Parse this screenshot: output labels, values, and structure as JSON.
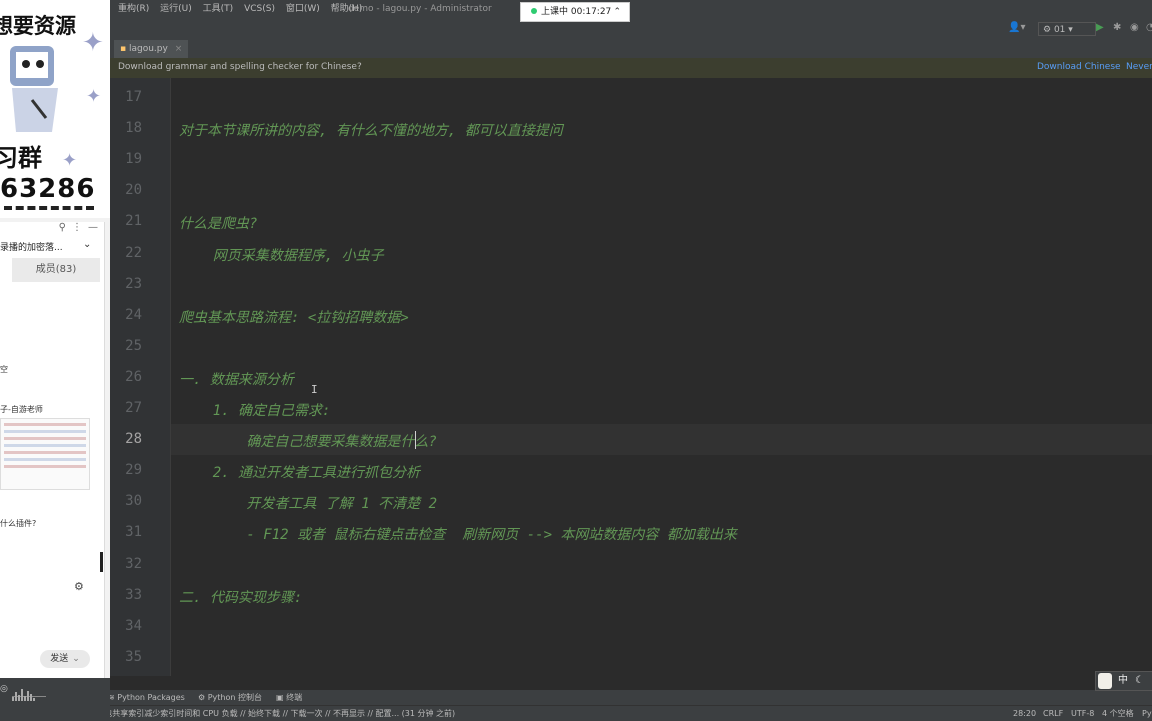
{
  "overlay": {
    "promo_line1": "想要资源",
    "promo_line2": "习群",
    "promo_line3": "63286",
    "chat": {
      "group_title": "录播的加密落...",
      "members_label": "成员(83)",
      "msg_1": "空",
      "msg_2": "子-自游老师",
      "msg_3": "什么插件?",
      "send_label": "发送"
    }
  },
  "ide": {
    "menu": [
      "重构(R)",
      "运行(U)",
      "工具(T)",
      "VCS(S)",
      "窗口(W)",
      "帮助(H)"
    ],
    "window_title": "demo - lagou.py - Administrator",
    "timer_label": "上课中 00:17:27",
    "run_config": "01",
    "tab_name": "lagou.py",
    "notice": {
      "message": "Download grammar and spelling checker for Chinese?",
      "action_download": "Download Chinese",
      "action_never": "Never"
    },
    "current_line": 28,
    "lines": [
      {
        "n": "17",
        "text": ""
      },
      {
        "n": "18",
        "text": "对于本节课所讲的内容, 有什么不懂的地方, 都可以直接提问"
      },
      {
        "n": "19",
        "text": ""
      },
      {
        "n": "20",
        "text": ""
      },
      {
        "n": "21",
        "text": "什么是爬虫?"
      },
      {
        "n": "22",
        "text": "    网页采集数据程序, 小虫子"
      },
      {
        "n": "23",
        "text": ""
      },
      {
        "n": "24",
        "text": "爬虫基本思路流程: <拉钩招聘数据>"
      },
      {
        "n": "25",
        "text": ""
      },
      {
        "n": "26",
        "text": "一. 数据来源分析"
      },
      {
        "n": "27",
        "text": "    1. 确定自己需求:"
      },
      {
        "n": "28",
        "text": "        确定自己想要采集数据是什么?"
      },
      {
        "n": "29",
        "text": "    2. 通过开发者工具进行抓包分析"
      },
      {
        "n": "30",
        "text": "        开发者工具 了解 1 不清楚 2"
      },
      {
        "n": "31",
        "text": "        - F12 或者 鼠标右键点击检查  刷新网页 --> 本网站数据内容 都加载出来"
      },
      {
        "n": "32",
        "text": ""
      },
      {
        "n": "33",
        "text": "二. 代码实现步骤:"
      },
      {
        "n": "34",
        "text": ""
      },
      {
        "n": "35",
        "text": ""
      }
    ],
    "tool_windows": [
      "Python Packages",
      "Python 控制台",
      "终端"
    ],
    "status": {
      "message": "II: 使用预构建的Python 软件包共享索引减少索引时间和 CPU 负载 // 始终下载 // 下载一次 // 不再显示 // 配置... (31 分钟 之前)",
      "position": "28:20",
      "line_sep": "CRLF",
      "encoding": "UTF-8",
      "indent": "4 个空格",
      "interpreter": "Py"
    },
    "ime_label": "中"
  }
}
